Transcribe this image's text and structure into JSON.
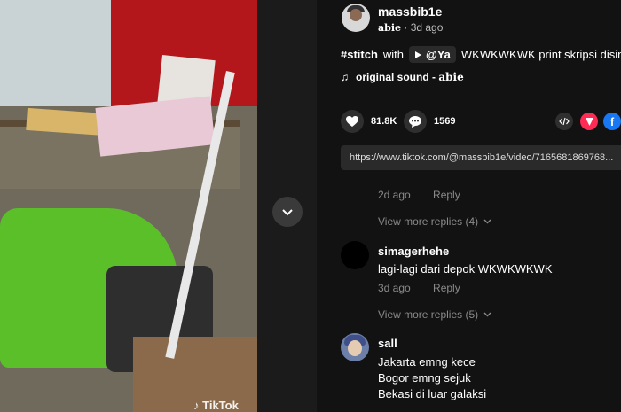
{
  "video": {
    "watermark": "TikTok"
  },
  "author": {
    "username": "massbib1e",
    "display_name": "abie",
    "time": "3d ago"
  },
  "caption": {
    "hashtag": "#stitch",
    "with_text": "with",
    "mention": "@Ya",
    "text": "WKWKWKWK print skripsi disini ju"
  },
  "sound": {
    "label": "original sound -",
    "author": "abie"
  },
  "actions": {
    "likes": "81.8K",
    "comments": "1569"
  },
  "share_url": "https://www.tiktok.com/@massbib1e/video/7165681869768...",
  "thread": {
    "prev_meta": {
      "time": "2d ago",
      "reply_label": "Reply"
    },
    "view_more_1": "View more replies (4)",
    "comments": [
      {
        "username": "simagerhehe",
        "lines": [
          "lagi-lagi dari depok WKWKWKWK"
        ],
        "time": "3d ago",
        "reply_label": "Reply",
        "view_more": "View more replies (5)"
      },
      {
        "username": "sall",
        "lines": [
          "Jakarta emng kece",
          "Bogor emng sejuk",
          "Bekasi di luar galaksi"
        ]
      }
    ]
  },
  "icons": {
    "heart": "heart-icon",
    "comment": "comment-icon",
    "embed": "code-icon",
    "send": "send-icon",
    "facebook": "facebook-icon",
    "music": "music-note-icon",
    "chevron": "chevron-down-icon"
  },
  "colors": {
    "background": "#121212",
    "send_red": "#fe2c55",
    "facebook_blue": "#1877f2"
  }
}
